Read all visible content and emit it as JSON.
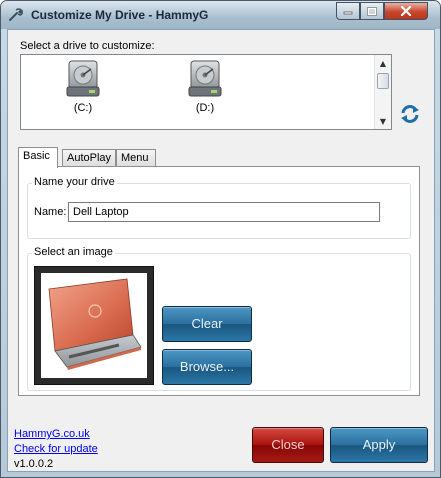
{
  "window": {
    "title": "Customize My Drive - HammyG",
    "icon": "wrench-icon"
  },
  "drive_list": {
    "label": "Select a drive to customize:",
    "drives": [
      {
        "label": "(C:)",
        "icon": "hard-drive-icon"
      },
      {
        "label": "(D:)",
        "icon": "hard-drive-icon"
      }
    ]
  },
  "tabs": [
    {
      "label": "Basic",
      "active": true
    },
    {
      "label": "AutoPlay",
      "active": false
    },
    {
      "label": "Menu",
      "active": false
    }
  ],
  "name_group": {
    "title": "Name your drive",
    "field_label": "Name:",
    "value": "Dell Laptop"
  },
  "image_group": {
    "title": "Select an image",
    "clear_label": "Clear",
    "browse_label": "Browse..."
  },
  "footer": {
    "website_link": "HammyG.co.uk",
    "update_link": "Check for update",
    "version": "v1.0.0.2",
    "close_label": "Close",
    "apply_label": "Apply"
  },
  "colors": {
    "accent_blue": "#2b6f9f",
    "close_red": "#a9110c"
  }
}
